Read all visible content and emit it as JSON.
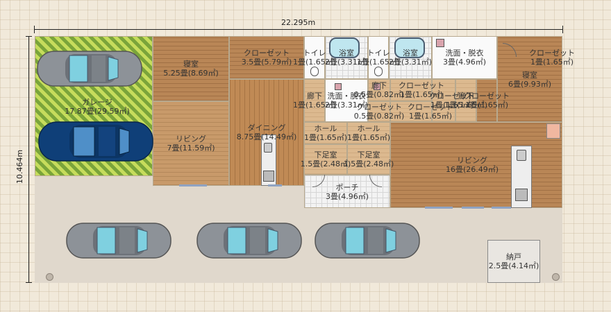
{
  "dimensions": {
    "width": "22.295m",
    "height": "10.464m"
  },
  "rooms": {
    "garage": {
      "name": "ガレージ",
      "area": "17.87畳(29.59㎡)"
    },
    "bedroom1": {
      "name": "寝室",
      "area": "5.25畳(8.69㎡)"
    },
    "living1": {
      "name": "リビング",
      "area": "7畳(11.59㎡)"
    },
    "closet1": {
      "name": "クローゼット",
      "area": "3.5畳(5.79㎡)"
    },
    "dining": {
      "name": "ダイニング",
      "area": "8.75畳(14.49㎡)"
    },
    "toilet1": {
      "name": "トイレ",
      "area": "1畳(1.65㎡)"
    },
    "bath1": {
      "name": "浴室",
      "area": "2畳(3.31㎡)"
    },
    "toilet2": {
      "name": "トイレ",
      "area": "1畳(1.65㎡)"
    },
    "bath2": {
      "name": "浴室",
      "area": "2畳(3.31㎡)"
    },
    "washroom1": {
      "name": "洗面・脱衣",
      "area": "3畳(4.96㎡)"
    },
    "closet2": {
      "name": "クローゼット",
      "area": "1畳(1.65㎡)"
    },
    "bedroom2": {
      "name": "寝室",
      "area": "6畳(9.93㎡)"
    },
    "corridor1": {
      "name": "廊下",
      "area": "1畳(1.65㎡)"
    },
    "washroom2": {
      "name": "洗面・脱衣",
      "area": "2畳(3.31㎡)"
    },
    "corridor2": {
      "name": "廊下",
      "area": "0.5畳(0.82㎡)"
    },
    "closet3": {
      "name": "クローゼット",
      "area": "0.5畳(0.82㎡)"
    },
    "closet4": {
      "name": "クローゼット",
      "area": "1畳(1.65㎡)"
    },
    "closet5": {
      "name": "クローゼット",
      "area": "1畳(1.65㎡)"
    },
    "closet6": {
      "name": "クローゼット",
      "area": "1畳(1.65㎡)"
    },
    "corridor3": {
      "name": "廊下",
      "area": "1畳(1.65㎡)"
    },
    "closet7": {
      "name": "クローゼット",
      "area": "1畳(1.65㎡)"
    },
    "hall1": {
      "name": "ホール",
      "area": "1畳(1.65㎡)"
    },
    "hall2": {
      "name": "ホール",
      "area": "1畳(1.65㎡)"
    },
    "entrance1": {
      "name": "下足室",
      "area": "1.5畳(2.48㎡)"
    },
    "entrance2": {
      "name": "下足室",
      "area": "1.5畳(2.48㎡)"
    },
    "porch": {
      "name": "ポーチ",
      "area": "3畳(4.96㎡)"
    },
    "living2": {
      "name": "リビング",
      "area": "16畳(26.49㎡)"
    },
    "storage": {
      "name": "納戸",
      "area": "2.5畳(4.14㎡)"
    }
  },
  "colors": {
    "garage_car_blue": "#0f3f78",
    "car_gray": "#8d9298",
    "car_glass": "#7fd0e0"
  }
}
